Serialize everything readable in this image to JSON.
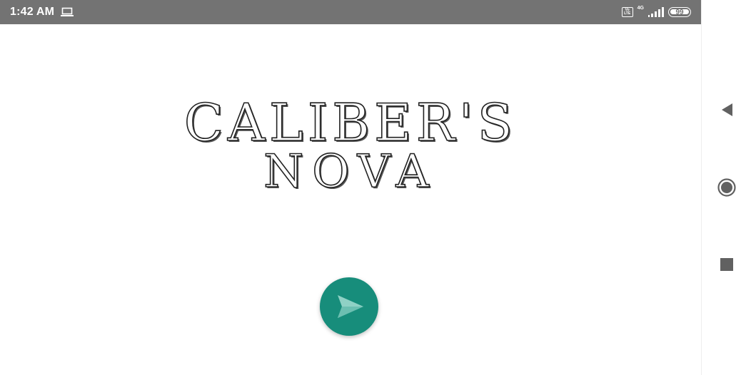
{
  "status_bar": {
    "time": "1:42 AM",
    "volte_top": "Vo",
    "volte_bottom": "LTE",
    "network_type": "4G",
    "battery_level": "99",
    "battery_fraction": 0.99,
    "icons": [
      "laptop-icon",
      "volte-icon",
      "signal-icon",
      "battery-icon"
    ],
    "background_color": "#737373"
  },
  "main": {
    "logo_line1": "CALIBER'S",
    "logo_line2": "NOVA",
    "play_button_color": "#178d7b",
    "play_icon": "send-arrow-icon"
  },
  "nav_bar": {
    "icons": [
      "back-triangle-icon",
      "home-circle-icon",
      "recents-square-icon"
    ],
    "icon_color": "#616161"
  }
}
